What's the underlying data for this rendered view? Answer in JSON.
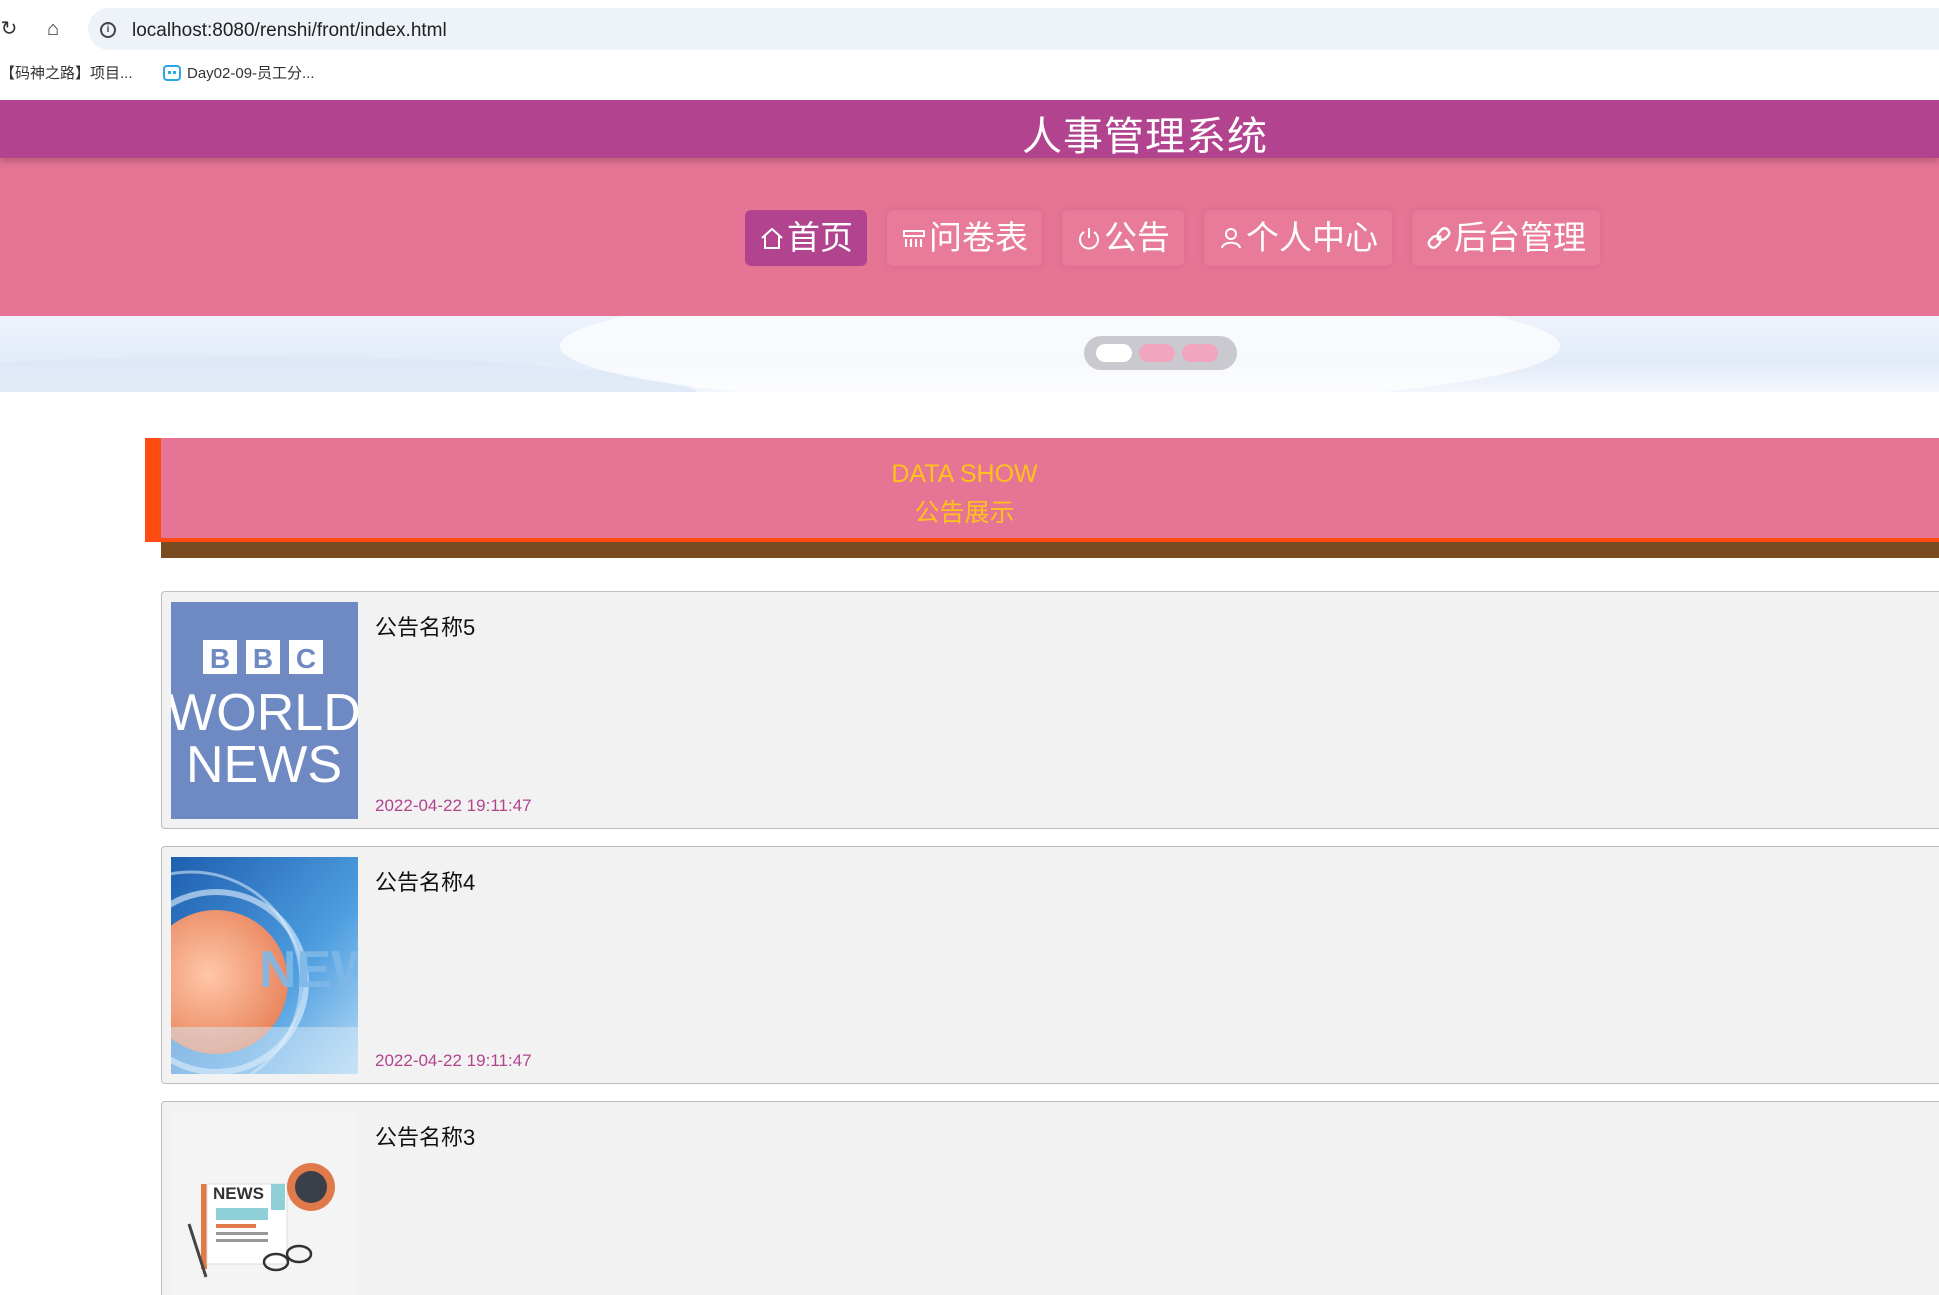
{
  "browser": {
    "url": "localhost:8080/renshi/front/index.html",
    "bookmarks": [
      "【码神之路】项目...",
      "Day02-09-员工分..."
    ]
  },
  "site": {
    "title": "人事管理系统",
    "nav": [
      {
        "label": "首页",
        "icon": "home-icon",
        "active": true
      },
      {
        "label": "问卷表",
        "icon": "grid-icon",
        "active": false
      },
      {
        "label": "公告",
        "icon": "power-icon",
        "active": false
      },
      {
        "label": "个人中心",
        "icon": "user-icon",
        "active": false
      },
      {
        "label": "后台管理",
        "icon": "link-icon",
        "active": false
      }
    ]
  },
  "carousel": {
    "slide_count": 3,
    "active_index": 0
  },
  "section": {
    "title_en": "DATA SHOW",
    "title_zh": "公告展示"
  },
  "news": [
    {
      "title": "公告名称5",
      "date": "2022-04-22 19:11:47",
      "image": "bbc-world-news"
    },
    {
      "title": "公告名称4",
      "date": "2022-04-22 19:11:47",
      "image": "globe-news"
    },
    {
      "title": "公告名称3",
      "date": "",
      "image": "newspaper-illustration"
    }
  ],
  "colors": {
    "title_bar": "#b2448f",
    "nav_band": "#e57495",
    "section_accent": "#ff4a12",
    "section_text": "#ffc21a",
    "date_text": "#b2448f"
  }
}
